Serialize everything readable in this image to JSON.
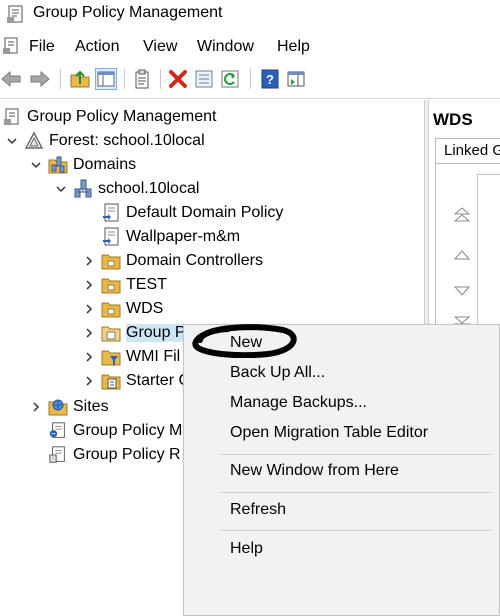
{
  "window": {
    "title": "Group Policy Management"
  },
  "menubar": {
    "items": [
      "File",
      "Action",
      "View",
      "Window",
      "Help"
    ]
  },
  "toolbar": {
    "buttons": [
      "back-icon",
      "forward-icon",
      "up-folder-icon",
      "show-hide-tree-icon",
      "properties-icon",
      "delete-icon",
      "export-list-icon",
      "refresh-icon",
      "help-icon",
      "show-action-pane-icon"
    ]
  },
  "tree": {
    "root": "Group Policy Management",
    "forest": "Forest: school.10local",
    "domains": "Domains",
    "domain": "school.10local",
    "default_policy": "Default Domain Policy",
    "wallpaper": "Wallpaper-m&m",
    "domain_controllers": "Domain Controllers",
    "test": "TEST",
    "wds": "WDS",
    "group_policy_objects": "Group P",
    "wmi_filters": "WMI Fil",
    "starter_gpos": "Starter G",
    "sites": "Sites",
    "modeling": "Group Policy M",
    "results": "Group Policy R"
  },
  "right_pane": {
    "title": "WDS",
    "tab": "Linked G"
  },
  "context_menu": {
    "items": [
      "New",
      "Back Up All...",
      "Manage Backups...",
      "Open Migration Table Editor",
      "New Window from Here",
      "Refresh",
      "Help"
    ]
  },
  "colors": {
    "selection": "#cde6f7",
    "menu_bg": "#f2f2f2",
    "folder": "#e8b84a",
    "delete_red": "#d0281c",
    "help_blue": "#2b5fb8"
  }
}
